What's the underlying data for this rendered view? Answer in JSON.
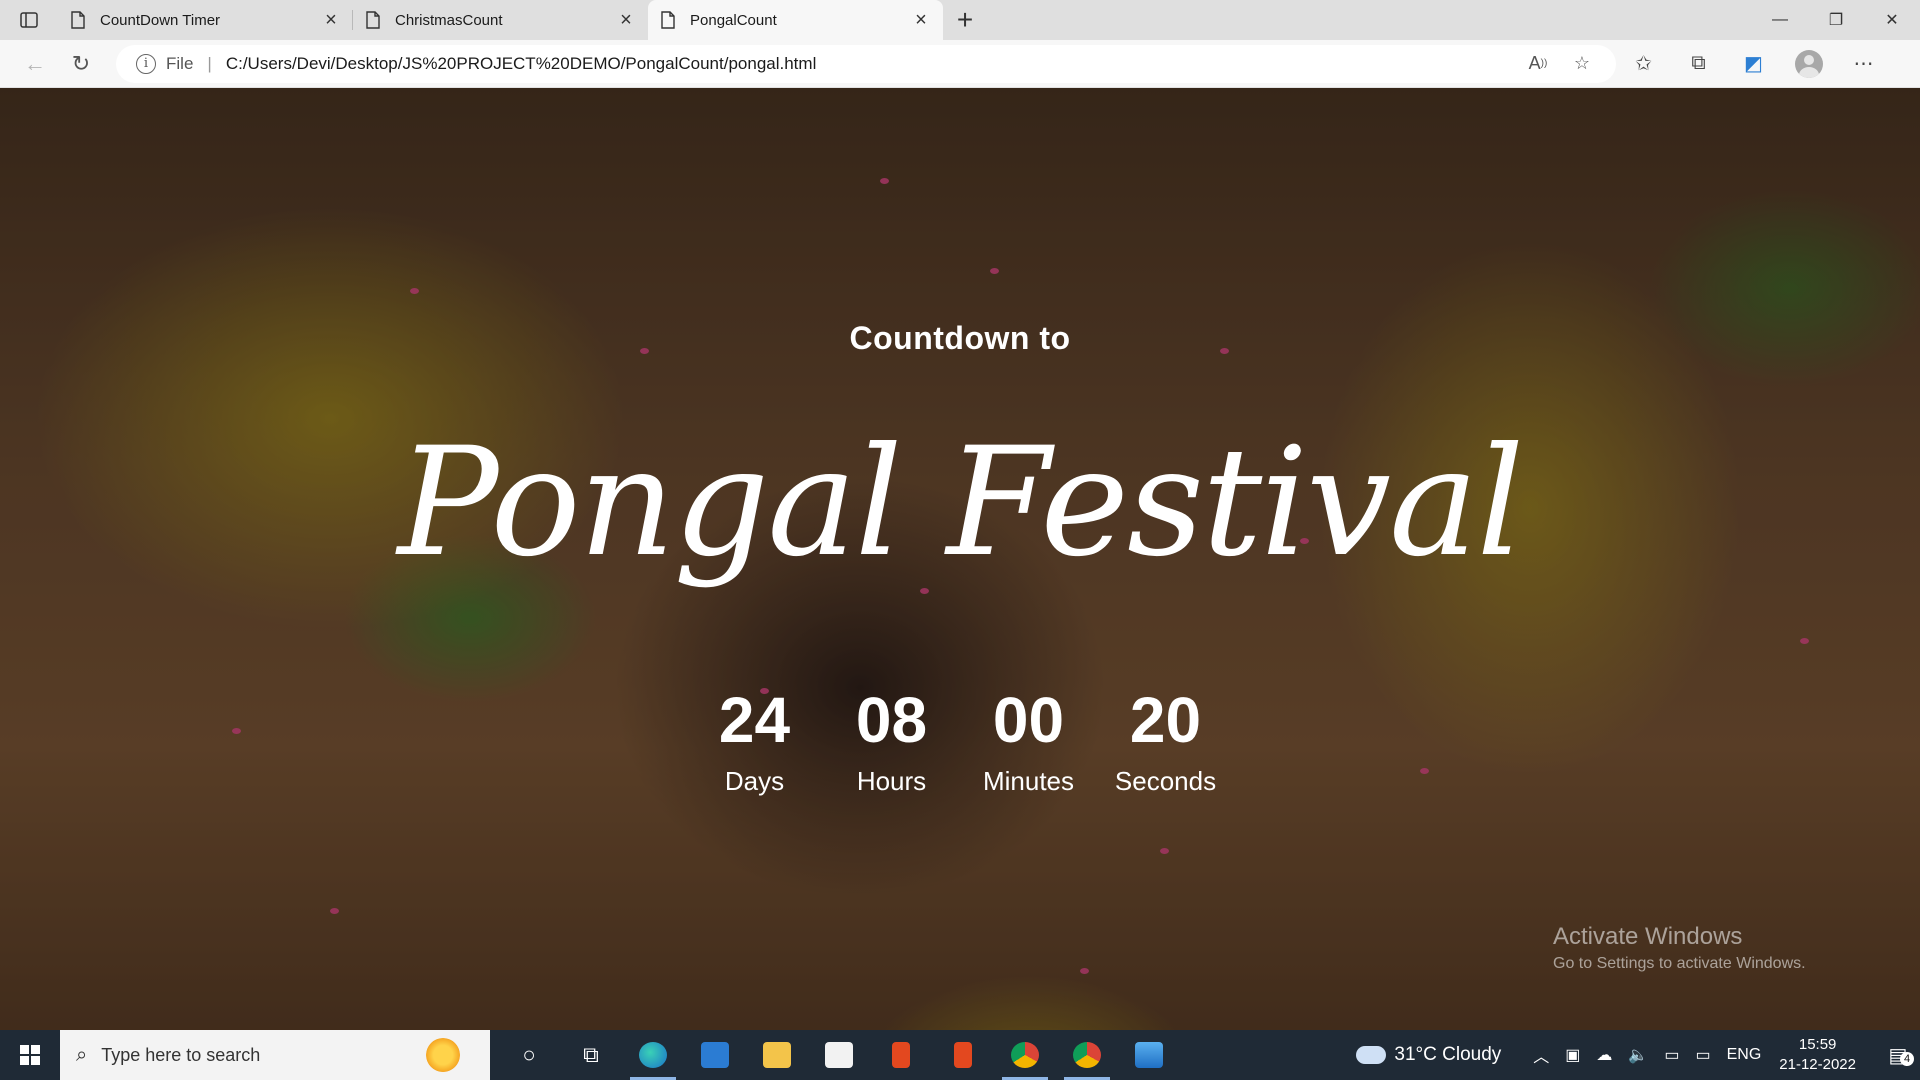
{
  "browser": {
    "tabs": [
      {
        "title": "CountDown Timer",
        "active": false
      },
      {
        "title": "ChristmasCount",
        "active": false
      },
      {
        "title": "PongalCount",
        "active": true
      }
    ],
    "address": {
      "scheme_label": "File",
      "url": "C:/Users/Devi/Desktop/JS%20PROJECT%20DEMO/PongalCount/pongal.html"
    },
    "icons": {
      "back": "back-arrow-icon",
      "reload": "reload-icon",
      "read_aloud": "read-aloud-icon",
      "add_favorite": "add-favorite-icon",
      "favorites": "favorites-icon",
      "collections": "collections-icon",
      "performance": "edge-performance-icon",
      "profile": "profile-avatar-icon",
      "menu": "more-menu-icon"
    }
  },
  "page": {
    "pre_title": "Countdown to",
    "title": "Pongal Festival",
    "countdown": [
      {
        "value": "24",
        "label": "Days"
      },
      {
        "value": "08",
        "label": "Hours"
      },
      {
        "value": "00",
        "label": "Minutes"
      },
      {
        "value": "20",
        "label": "Seconds"
      }
    ]
  },
  "watermark": {
    "line1": "Activate Windows",
    "line2": "Go to Settings to activate Windows."
  },
  "taskbar": {
    "search_placeholder": "Type here to search",
    "weather": "31°C  Cloudy",
    "language": "ENG",
    "time": "15:59",
    "date": "21-12-2022",
    "notification_count": "4",
    "apps": [
      "cortana",
      "task-view",
      "edge",
      "mail",
      "file-explorer",
      "store",
      "office",
      "office-2",
      "chrome",
      "chrome-2",
      "photos"
    ]
  },
  "colors": {
    "accent_pink": "#e24a8a",
    "taskbar_bg": "#1f2a36",
    "tab_strip_bg": "#dfdfdf"
  }
}
